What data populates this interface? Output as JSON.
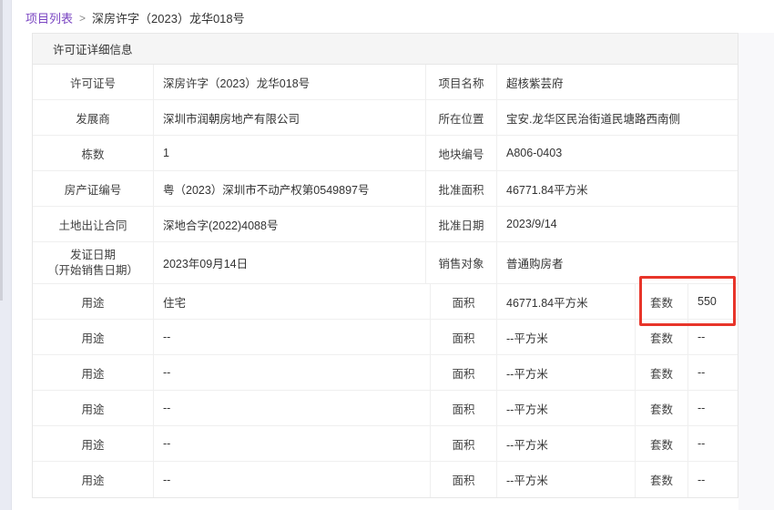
{
  "breadcrumb": {
    "list_label": "项目列表",
    "separator": ">",
    "current": "深房许字（2023）龙华018号"
  },
  "panel": {
    "title": "许可证详细信息"
  },
  "info_rows": [
    {
      "label1": "许可证号",
      "value1": "深房许字（2023）龙华018号",
      "label2": "项目名称",
      "value2": "超核紫芸府"
    },
    {
      "label1": "发展商",
      "value1": "深圳市润朝房地产有限公司",
      "label2": "所在位置",
      "value2": "宝安.龙华区民治街道民塘路西南侧"
    },
    {
      "label1": "栋数",
      "value1": "1",
      "label2": "地块编号",
      "value2": "A806-0403"
    },
    {
      "label1": "房产证编号",
      "value1": "粤（2023）深圳市不动产权第0549897号",
      "label2": "批准面积",
      "value2": "46771.84平方米"
    },
    {
      "label1": "土地出让合同",
      "value1": "深地合字(2022)4088号",
      "label2": "批准日期",
      "value2": "2023/9/14"
    },
    {
      "label1": "发证日期",
      "label1_sub": "（开始销售日期）",
      "value1": "2023年09月14日",
      "label2": "销售对象",
      "value2": "普通购房者"
    }
  ],
  "usage_rows": [
    {
      "use_label": "用途",
      "use": "住宅",
      "area_label": "面积",
      "area": "46771.84平方米",
      "units_label": "套数",
      "units": "550",
      "highlight": true
    },
    {
      "use_label": "用途",
      "use": "--",
      "area_label": "面积",
      "area": "--平方米",
      "units_label": "套数",
      "units": "--",
      "highlight": false
    },
    {
      "use_label": "用途",
      "use": "--",
      "area_label": "面积",
      "area": "--平方米",
      "units_label": "套数",
      "units": "--",
      "highlight": false
    },
    {
      "use_label": "用途",
      "use": "--",
      "area_label": "面积",
      "area": "--平方米",
      "units_label": "套数",
      "units": "--",
      "highlight": false
    },
    {
      "use_label": "用途",
      "use": "--",
      "area_label": "面积",
      "area": "--平方米",
      "units_label": "套数",
      "units": "--",
      "highlight": false
    },
    {
      "use_label": "用途",
      "use": "--",
      "area_label": "面积",
      "area": "--平方米",
      "units_label": "套数",
      "units": "--",
      "highlight": false
    }
  ],
  "colors": {
    "accent_purple": "#7a45c2",
    "highlight_red": "#e8352a",
    "header_bg": "#f5f5f5"
  }
}
